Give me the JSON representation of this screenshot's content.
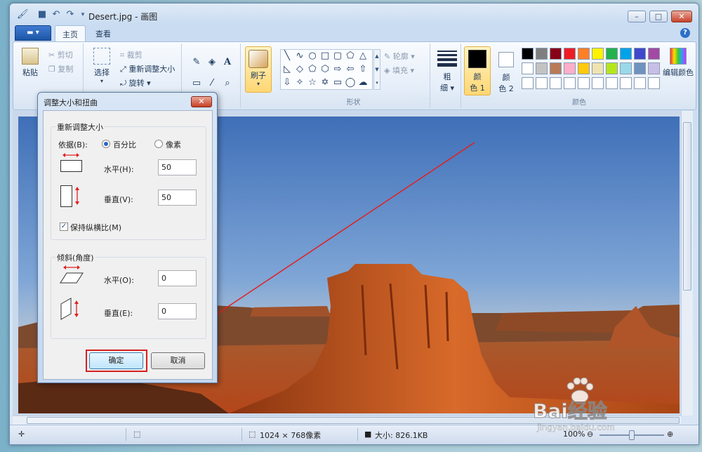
{
  "window": {
    "title": "Desert.jpg - 画图"
  },
  "tabs": [
    {
      "label": "主页"
    },
    {
      "label": "查看"
    }
  ],
  "ribbon": {
    "clipboard": {
      "paste": "粘贴",
      "cut": "剪切",
      "copy": "复制"
    },
    "image": {
      "select": "选择",
      "crop": "裁剪",
      "resize": "重新调整大小",
      "rotate": "旋转"
    },
    "brushes": {
      "label": "刷子"
    },
    "shapes": {
      "outline": "轮廓",
      "fill": "填充",
      "group_label": "形状"
    },
    "size": {
      "label_line1": "粗",
      "label_line2": "细"
    },
    "colors": {
      "color1_line1": "颜",
      "color1_line2": "色 1",
      "color2_line1": "颜",
      "color2_line2": "色 2",
      "edit": "编辑颜色",
      "group_label": "颜色",
      "color1_value": "#000000",
      "color2_value": "#ffffff",
      "palette": [
        "#000000",
        "#7f7f7f",
        "#880015",
        "#ed1c24",
        "#ff7f27",
        "#fff200",
        "#22b14c",
        "#00a2e8",
        "#3f48cc",
        "#a349a4",
        "#ffffff",
        "#c3c3c3",
        "#b97a57",
        "#ffaec9",
        "#ffc90e",
        "#efe4b0",
        "#b5e61d",
        "#99d9ea",
        "#7092be",
        "#c8bfe7"
      ]
    }
  },
  "dialog": {
    "title": "调整大小和扭曲",
    "resize": {
      "legend": "重新调整大小",
      "by_label": "依据(B):",
      "percent_label": "百分比",
      "pixels_label": "像素",
      "horizontal_label": "水平(H):",
      "horizontal_value": "50",
      "vertical_label": "垂直(V):",
      "vertical_value": "50",
      "keep_ratio_label": "保持纵横比(M)"
    },
    "skew": {
      "legend": "倾斜(角度)",
      "horizontal_label": "水平(O):",
      "horizontal_value": "0",
      "vertical_label": "垂直(E):",
      "vertical_value": "0"
    },
    "ok_label": "确定",
    "cancel_label": "取消"
  },
  "status": {
    "dimensions": "1024 × 768像素",
    "size": "大小: 826.1KB",
    "zoom": "100%"
  },
  "watermark": {
    "text": "Bai经验",
    "url": "jingyan.baidu.com"
  }
}
